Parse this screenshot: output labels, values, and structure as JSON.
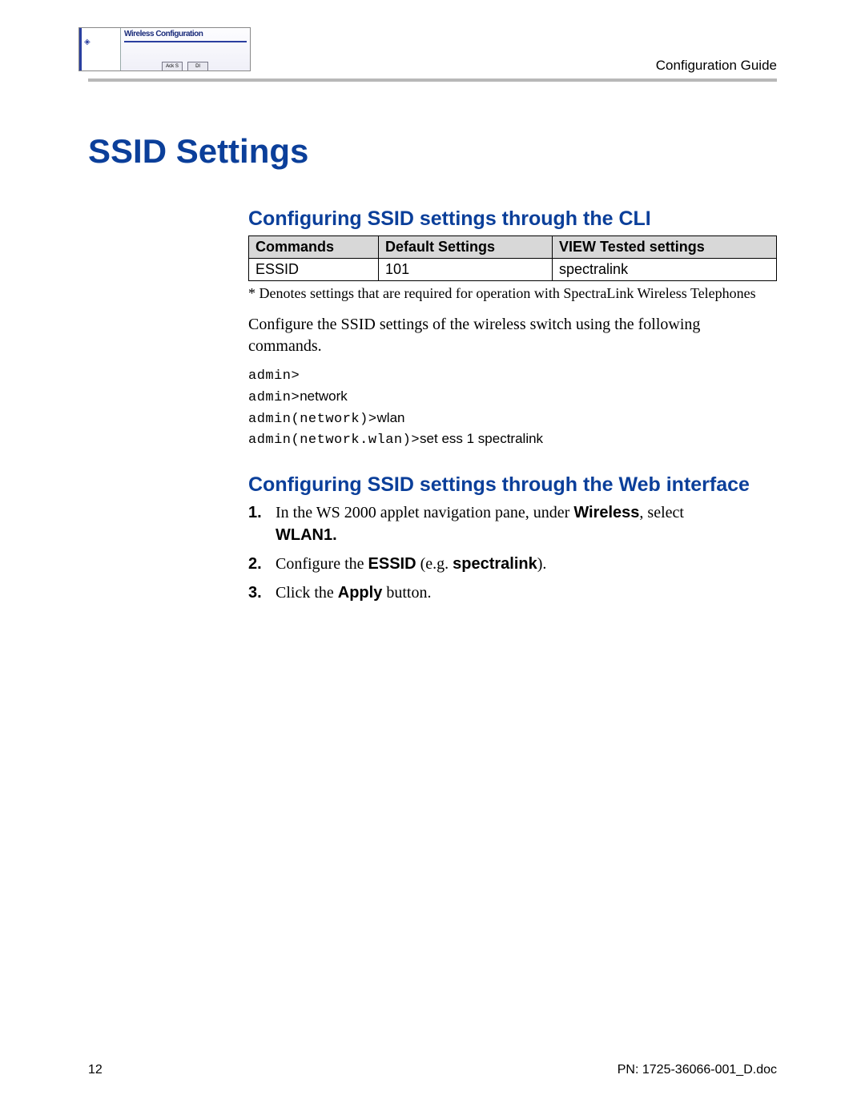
{
  "header": {
    "right_label": "Configuration Guide",
    "thumb_title": "Wireless Configuration",
    "thumb_btn1": "Ack S",
    "thumb_btn2": "Dl"
  },
  "title": "SSID Settings",
  "section1": {
    "heading": "Configuring SSID settings through the CLI",
    "table": {
      "headers": [
        "Commands",
        "Default Settings",
        "VIEW Tested settings"
      ],
      "row": [
        "ESSID",
        "101",
        "spectralink"
      ]
    },
    "footnote": "* Denotes settings that are required for operation with SpectraLink Wireless Telephones",
    "body": "Configure the SSID settings of the wireless switch using the following commands.",
    "cli": {
      "l1a": "admin>",
      "l2a": "admin>",
      "l2b": "network",
      "l3a": "admin(network)>",
      "l3b": "wlan",
      "l4a": "admin(network.wlan)>",
      "l4b": "set ess 1 spectralink"
    }
  },
  "section2": {
    "heading": "Configuring SSID settings through the Web interface",
    "steps": {
      "s1a": "In the WS 2000 applet navigation pane, under ",
      "s1b": "Wireless",
      "s1c": ", select ",
      "s1d": "WLAN1.",
      "s2a": "Configure the ",
      "s2b": "ESSID",
      "s2c": " (e.g. ",
      "s2d": "spectralink",
      "s2e": ").",
      "s3a": "Click the ",
      "s3b": "Apply",
      "s3c": " button."
    }
  },
  "footer": {
    "page": "12",
    "pn": "PN: 1725-36066-001_D.doc"
  }
}
